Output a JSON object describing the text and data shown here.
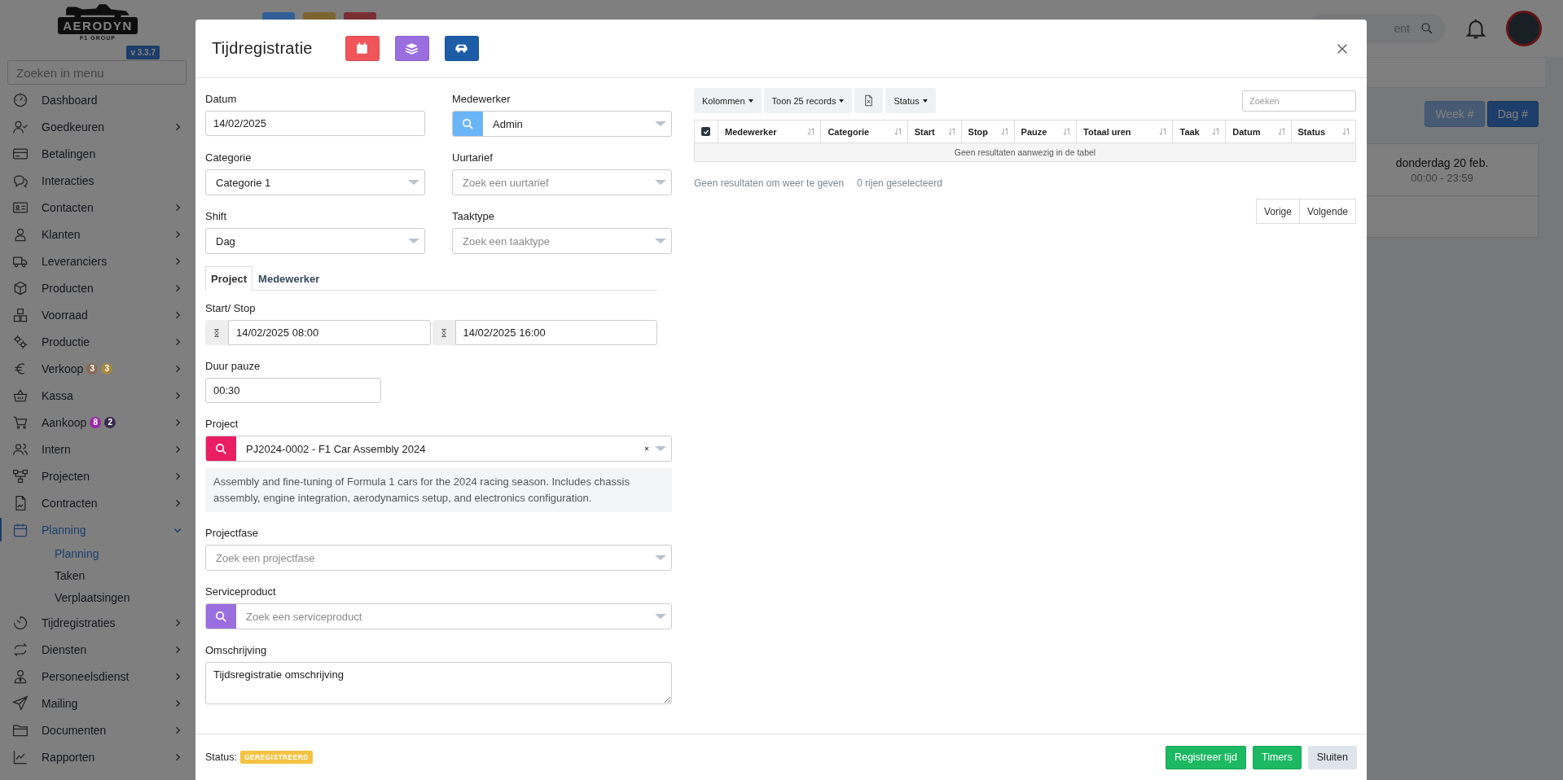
{
  "sidebar": {
    "logo_text": "AERODYN",
    "logo_subtext": "F1 GROUP",
    "version": "v 3.3.7",
    "search": {
      "placeholder": "Zoeken in menu"
    },
    "items": [
      {
        "label": "Dashboard",
        "selected": false,
        "kind": "link",
        "expanded": false
      },
      {
        "label": "Goedkeuren",
        "selected": false,
        "kind": "group",
        "expanded": false
      },
      {
        "label": "Betalingen",
        "selected": false,
        "kind": "link",
        "expanded": false
      },
      {
        "label": "Interacties",
        "selected": false,
        "kind": "link",
        "expanded": false
      },
      {
        "label": "Contacten",
        "selected": false,
        "kind": "group",
        "expanded": false
      },
      {
        "label": "Klanten",
        "selected": false,
        "kind": "group",
        "expanded": false
      },
      {
        "label": "Leveranciers",
        "selected": false,
        "kind": "group",
        "expanded": false
      },
      {
        "label": "Producten",
        "selected": false,
        "kind": "group",
        "expanded": false
      },
      {
        "label": "Voorraad",
        "selected": false,
        "kind": "group",
        "expanded": false
      },
      {
        "label": "Productie",
        "selected": false,
        "kind": "group",
        "expanded": false
      },
      {
        "label": "Verkoop",
        "selected": false,
        "kind": "group",
        "expanded": false,
        "badges": [
          {
            "text": "3",
            "color": "#8a6a58"
          },
          {
            "text": "3",
            "color": "#a8893c"
          }
        ]
      },
      {
        "label": "Kassa",
        "selected": false,
        "kind": "group",
        "expanded": false
      },
      {
        "label": "Aankoop",
        "selected": false,
        "kind": "group",
        "expanded": false,
        "badges": [
          {
            "text": "8",
            "color": "#9a2aa6"
          },
          {
            "text": "2",
            "color": "#3a2a4a"
          }
        ]
      },
      {
        "label": "Intern",
        "selected": false,
        "kind": "group",
        "expanded": false
      },
      {
        "label": "Projecten",
        "selected": false,
        "kind": "group",
        "expanded": false
      },
      {
        "label": "Contracten",
        "selected": false,
        "kind": "group",
        "expanded": false
      },
      {
        "label": "Planning",
        "selected": true,
        "kind": "group",
        "expanded": true,
        "children": [
          {
            "label": "Planning",
            "selected": true
          },
          {
            "label": "Taken",
            "selected": false
          },
          {
            "label": "Verplaatsingen",
            "selected": false
          }
        ]
      },
      {
        "label": "Tijdregistraties",
        "selected": false,
        "kind": "group",
        "expanded": false
      },
      {
        "label": "Diensten",
        "selected": false,
        "kind": "group",
        "expanded": false
      },
      {
        "label": "Personeelsdienst",
        "selected": false,
        "kind": "group",
        "expanded": false
      },
      {
        "label": "Mailing",
        "selected": false,
        "kind": "group",
        "expanded": false
      },
      {
        "label": "Documenten",
        "selected": false,
        "kind": "group",
        "expanded": false
      },
      {
        "label": "Rapporten",
        "selected": false,
        "kind": "group",
        "expanded": false
      }
    ]
  },
  "background": {
    "header_buttons": [
      {
        "color": "#2f5f95"
      },
      {
        "color": "#7d6530"
      },
      {
        "color": "#7a2f35"
      }
    ],
    "search": {
      "placeholder": "ent"
    },
    "view_buttons": [
      {
        "label": "Week #",
        "selected": false
      },
      {
        "label": "Dag #",
        "selected": true
      }
    ],
    "calendar_card": {
      "day": "donderdag 20 feb.",
      "time": "00:00 - 23:59"
    }
  },
  "modal": {
    "title": "Tijdregistratie",
    "header_buttons": [
      {
        "kind": "calendar",
        "color": "#f0555a"
      },
      {
        "kind": "layers",
        "color": "#9b6ee0"
      },
      {
        "kind": "car",
        "color": "#1d5ca6"
      }
    ],
    "top_fields": [
      {
        "label": "Datum",
        "kind": "text",
        "value": "14/02/2025"
      },
      {
        "label": "Medewerker",
        "kind": "select",
        "color": "#6ab4f8",
        "value": "Admin"
      },
      {
        "label": "Categorie",
        "kind": "select",
        "value": "Categorie 1"
      },
      {
        "label": "Uurtarief",
        "kind": "select",
        "placeholder": "Zoek een uurtarief"
      },
      {
        "label": "Shift",
        "kind": "select",
        "value": "Dag"
      },
      {
        "label": "Taaktype",
        "kind": "select",
        "placeholder": "Zoek een taaktype"
      }
    ],
    "tabs": [
      {
        "label": "Project",
        "selected": true
      },
      {
        "label": "Medewerker",
        "selected": false
      }
    ],
    "fields": [
      {
        "label": "Start/ Stop",
        "kind": "datetime_pair",
        "start": "14/02/2025 08:00",
        "end": "14/02/2025 16:00"
      },
      {
        "label": "Duur pauze",
        "kind": "text",
        "value": "00:30",
        "narrow": true
      },
      {
        "label": "Project",
        "kind": "select",
        "color": "#e91e63",
        "value": "PJ2024-0002 - F1 Car Assembly 2024",
        "clearable": true,
        "description": "Assembly and fine-tuning of Formula 1 cars for the 2024 racing season. Includes chassis assembly, engine integration, aerodynamics setup, and electronics configuration."
      },
      {
        "label": "Projectfase",
        "kind": "select",
        "placeholder": "Zoek een projectfase"
      },
      {
        "label": "Serviceproduct",
        "kind": "select",
        "color": "#9b6ee0",
        "placeholder": "Zoek een serviceproduct"
      },
      {
        "label": "Omschrijving",
        "kind": "textarea",
        "value": "Tijdsregistratie omschrijving"
      }
    ],
    "table": {
      "toolbar": [
        {
          "kind": "dropdown",
          "label": "Kolommen"
        },
        {
          "kind": "dropdown",
          "label": "Toon 25 records"
        },
        {
          "kind": "export"
        },
        {
          "kind": "dropdown",
          "label": "Status"
        }
      ],
      "search": {
        "placeholder": "Zoeken"
      },
      "select_all_checked": true,
      "columns": [
        "Medewerker",
        "Categorie",
        "Start",
        "Stop",
        "Pauze",
        "Totaal uren",
        "Taak",
        "Datum",
        "Status"
      ],
      "empty_message": "Geen resultaten aanwezig in de tabel",
      "info": "Geen resultaten om weer te geven",
      "selected_info": "0 rijen geselecteerd",
      "pagination": [
        "Vorige",
        "Volgende"
      ]
    },
    "footer": {
      "status_label": "Status:",
      "status_badge": "GEREGISTREERD",
      "buttons": [
        {
          "label": "Registreer tijd",
          "kind": "success"
        },
        {
          "label": "Timers",
          "kind": "success"
        },
        {
          "label": "Sluiten",
          "kind": "light"
        }
      ]
    }
  }
}
